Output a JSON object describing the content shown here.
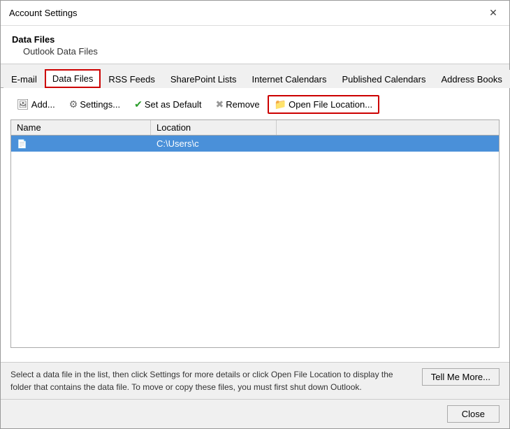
{
  "dialog": {
    "title": "Account Settings",
    "close_label": "✕"
  },
  "header": {
    "section_title": "Data Files",
    "section_sub": "Outlook Data Files"
  },
  "tabs": [
    {
      "id": "email",
      "label": "E-mail",
      "active": false
    },
    {
      "id": "data-files",
      "label": "Data Files",
      "active": true
    },
    {
      "id": "rss-feeds",
      "label": "RSS Feeds",
      "active": false
    },
    {
      "id": "sharepoint-lists",
      "label": "SharePoint Lists",
      "active": false
    },
    {
      "id": "internet-calendars",
      "label": "Internet Calendars",
      "active": false
    },
    {
      "id": "published-calendars",
      "label": "Published Calendars",
      "active": false
    },
    {
      "id": "address-books",
      "label": "Address Books",
      "active": false
    }
  ],
  "toolbar": {
    "add_label": "Add...",
    "settings_label": "Settings...",
    "set_default_label": "Set as Default",
    "remove_label": "Remove",
    "open_file_location_label": "Open File Location..."
  },
  "list": {
    "columns": [
      "Name",
      "Location"
    ],
    "rows": [
      {
        "icon": "📄",
        "name": "",
        "location": "C:\\Users\\c"
      }
    ]
  },
  "footer": {
    "text": "Select a data file in the list, then click Settings for more details or click Open File Location to display the folder that contains the data file. To move or copy these files, you must first shut down Outlook.",
    "tell_more_label": "Tell Me More..."
  },
  "bottom_bar": {
    "close_label": "Close"
  },
  "icons": {
    "add": "🖼",
    "settings": "⚙",
    "check": "✔",
    "remove": "✖",
    "folder": "📁"
  }
}
